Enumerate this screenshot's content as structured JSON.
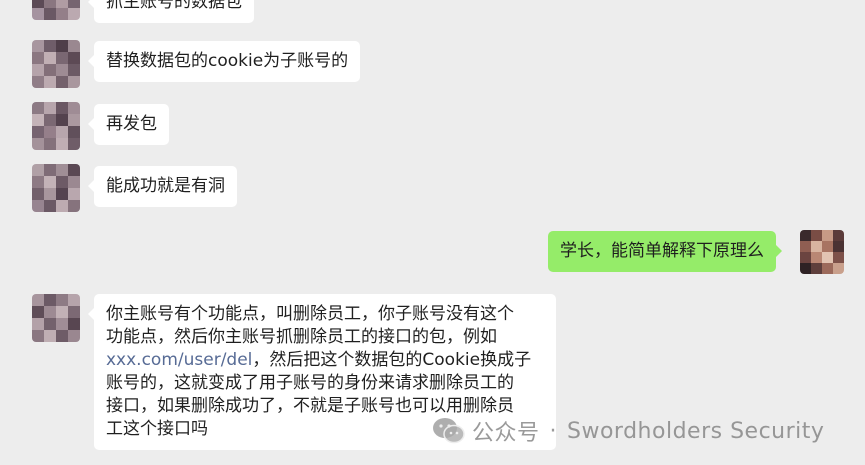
{
  "messages": [
    {
      "side": "left",
      "text": "抓主账号的数据包"
    },
    {
      "side": "left",
      "text": "替换数据包的cookie为子账号的"
    },
    {
      "side": "left",
      "text": "再发包"
    },
    {
      "side": "left",
      "text": "能成功就是有洞"
    },
    {
      "side": "right",
      "text": "学长，能简单解释下原理么"
    },
    {
      "side": "left",
      "lines": [
        "你主账号有个功能点，叫删除员工，你子账号没有这个",
        "功能点，然后你主账号抓删除员工的接口的包，例如"
      ],
      "link": "xxx.com/user/del",
      "after_link": "，然后把这个数据包的Cookie换成子",
      "tail_lines": [
        "账号的，这就变成了用子账号的身份来请求删除员工的",
        "接口，如果删除成功了，不就是子账号也可以用删除员",
        "工这个接口吗"
      ]
    }
  ],
  "watermark": {
    "icon": "wechat-icon",
    "account": "公众号",
    "separator": "·",
    "name": "Swordholders Security"
  },
  "colors": {
    "background": "#ededed",
    "bubble_other": "#ffffff",
    "bubble_self": "#95ec69",
    "link": "#576b95"
  }
}
